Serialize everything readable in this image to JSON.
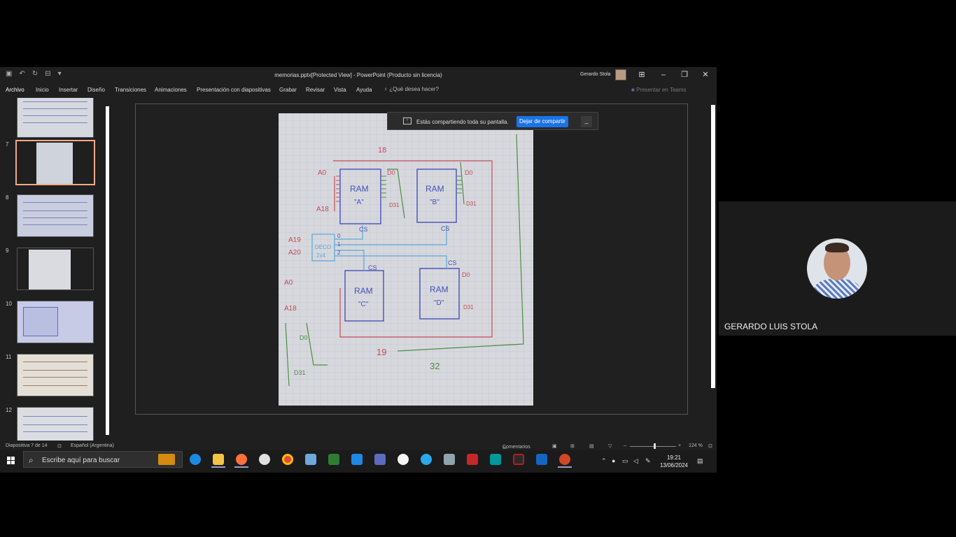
{
  "titlebar": {
    "doc_title": "memorias.pptx[Protected View] - PowerPoint (Producto sin licencia)",
    "user_name": "Gerardo Stola"
  },
  "ribbon": {
    "tabs": [
      "Archivo",
      "Inicio",
      "Insertar",
      "Diseño",
      "Transiciones",
      "Animaciones",
      "Presentación con diapositivas",
      "Grabar",
      "Revisar",
      "Vista",
      "Ayuda"
    ],
    "search_placeholder": "¿Qué desea hacer?",
    "teams_button": "Presentar en Teams"
  },
  "thumbnails": {
    "numbers": [
      "7",
      "8",
      "9",
      "10",
      "11",
      "12"
    ],
    "active": "7"
  },
  "share_bar": {
    "message": "Estás compartiendo toda su pantalla.",
    "stop_button": "Dejar de compartir",
    "minimize": "_"
  },
  "slide_sketch": {
    "labels": {
      "ram_a": "RAM",
      "ram_a_sub": "\"A\"",
      "ram_b": "RAM",
      "ram_b_sub": "\"B\"",
      "ram_c": "RAM",
      "ram_c_sub": "\"C\"",
      "ram_d": "RAM",
      "ram_d_sub": "\"D\"",
      "cs": "CS",
      "a0": "A0",
      "a18": "A18",
      "a19": "A19",
      "a20": "A20",
      "d0": "D0",
      "d31": "D31",
      "deco": "DECO",
      "deco_sub": "2x4",
      "n18": "18",
      "n19": "19",
      "n32": "32",
      "out0": "0",
      "out1": "1",
      "out2": "2"
    }
  },
  "statusbar": {
    "slide_count": "Diapositiva 7 de 14",
    "language": "Español (Argentina)",
    "comments": "Comentarios",
    "zoom": "124 %"
  },
  "taskbar": {
    "search_placeholder": "Escribe aquí para buscar",
    "time": "19:21",
    "date": "13/06/2024"
  },
  "participant": {
    "name": "GERARDO LUIS STOLA"
  }
}
